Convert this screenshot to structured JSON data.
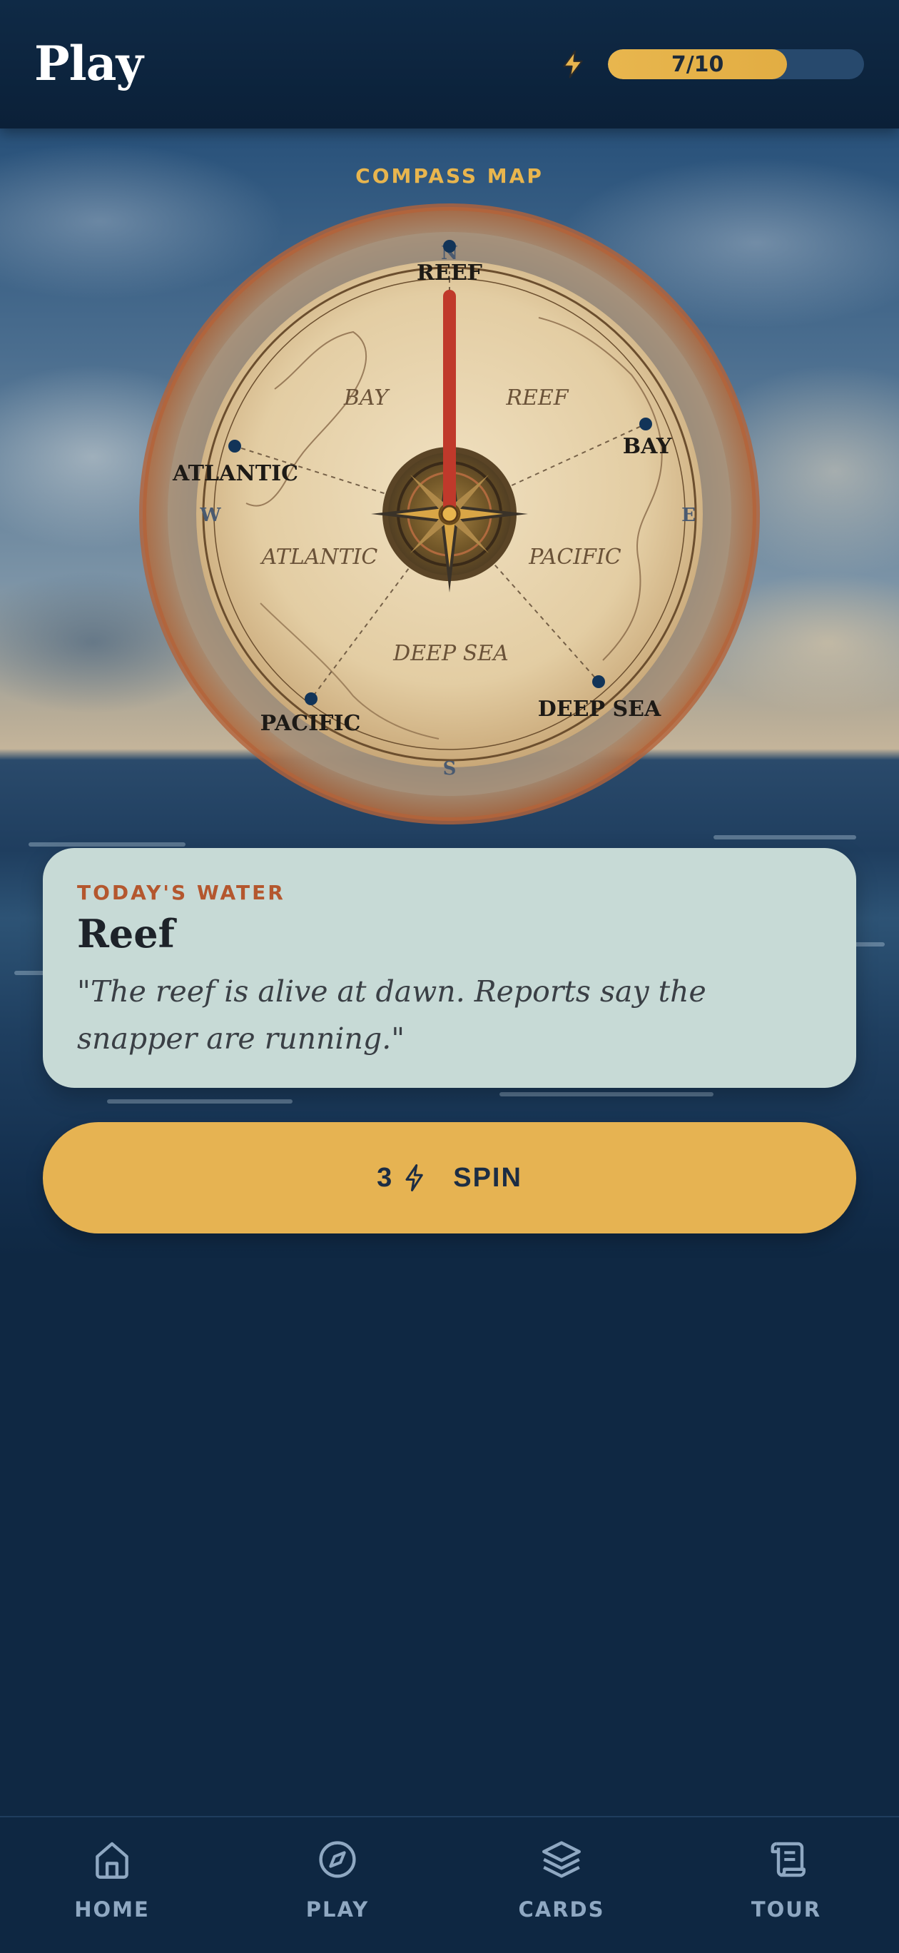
{
  "header": {
    "title": "Play",
    "energy": {
      "current": 7,
      "max": 10,
      "label": "7/10",
      "icon": "lightning-icon"
    }
  },
  "compass": {
    "label": "COMPASS MAP",
    "outer_labels": [
      "REEF",
      "BAY",
      "DEEP SEA",
      "PACIFIC",
      "ATLANTIC"
    ],
    "map_labels": [
      "BAY",
      "REEF",
      "ATLANTIC",
      "PACIFIC",
      "DEEP SEA"
    ],
    "cardinals": [
      "N",
      "E",
      "S",
      "W"
    ],
    "needle_pointing": "REEF"
  },
  "today_water": {
    "eyebrow": "TODAY'S WATER",
    "name": "Reef",
    "quote": "\"The reef is alive at dawn. Reports say the snapper are running.\""
  },
  "spin_button": {
    "cost": "3",
    "label": "SPIN",
    "icon": "lightning-icon"
  },
  "nav": {
    "items": [
      {
        "label": "HOME",
        "icon": "home-icon"
      },
      {
        "label": "PLAY",
        "icon": "compass-icon"
      },
      {
        "label": "CARDS",
        "icon": "layers-icon"
      },
      {
        "label": "TOUR",
        "icon": "scroll-icon"
      }
    ]
  },
  "colors": {
    "accent": "#e6b352",
    "background": "#0f2843",
    "card": "#c7dad6",
    "eyebrow": "#b4572e",
    "needle": "#c0392b"
  }
}
